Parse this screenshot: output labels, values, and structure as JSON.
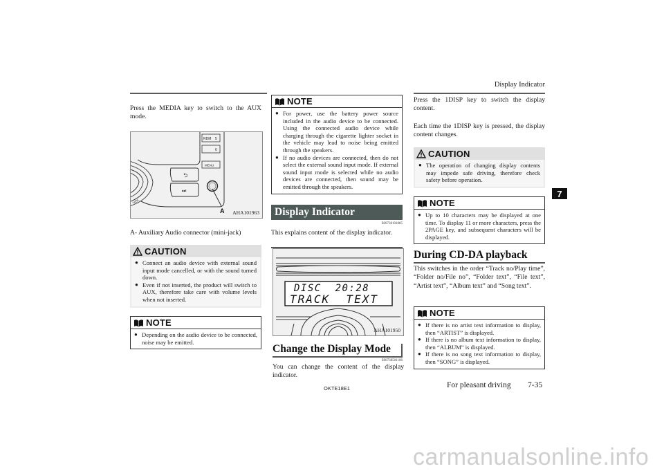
{
  "page": {
    "running_header": "Display Indicator",
    "chapter_tab": "7",
    "footer_code": "OKTE18E1",
    "footer_section": "For pleasant driving",
    "page_number": "7-35",
    "watermark": "carmanualsonline.info"
  },
  "col1": {
    "intro": "Press the MEDIA key to switch to the AUX mode.",
    "figure": {
      "code": "AHA101963",
      "labels": {
        "rdm": "RDM",
        "key5": "5",
        "key6": "6",
        "menu": "MENU",
        "callout": "A",
        "vol": "VOL"
      }
    },
    "figure_caption": "A- Auxiliary Audio connector (mini-jack)",
    "caution": {
      "icon": "warning-triangle-icon",
      "title": "CAUTION",
      "items": [
        "Connect an audio device with external sound input mode cancelled, or with the sound turned down.",
        "Even if not inserted, the product will switch to AUX, therefore take care with volume levels when not inserted."
      ]
    },
    "note": {
      "icon": "open-book-icon",
      "title": "NOTE",
      "items": [
        "Depending on the audio device to be connected, noise may be emitted."
      ]
    }
  },
  "col2": {
    "note": {
      "icon": "open-book-icon",
      "title": "NOTE",
      "items": [
        "For power, use the battery power source included in the audio device to be connected. Using the connected audio device while charging through the cigarette lighter socket in the vehicle may lead to noise being emitted through the speakers.",
        "If no audio devices are connected, then do not select the external sound input mode. If external sound input mode is selected while no audio devices are connected, then sound may be emitted through the speakers."
      ]
    },
    "section": {
      "title": "Display Indicator",
      "code": "E00738101085",
      "text": "This explains content of the display indicator."
    },
    "figure": {
      "code": "AHA101950",
      "lcd_line1": "DISC  20:28",
      "lcd_line2": "TRACK  TEXT"
    },
    "subsection": {
      "title": "Change the Display Mode",
      "code": "E00738501106",
      "text": "You can change the content of the display indicator."
    }
  },
  "col3": {
    "intro1": "Press the 1DISP key to switch the display content.",
    "intro2": "Each time the 1DISP key is pressed, the display content changes.",
    "caution": {
      "icon": "warning-triangle-icon",
      "title": "CAUTION",
      "items": [
        "The operation of changing display contents may impede safe driving, therefore check safety before operation."
      ]
    },
    "note1": {
      "icon": "open-book-icon",
      "title": "NOTE",
      "items": [
        "Up to 10 characters may be displayed at one time. To display 11 or more characters, press the 2PAGE key, and subsequent characters will be displayed."
      ]
    },
    "subsection": {
      "title": "During CD-DA playback",
      "text": "This switches in the order “Track no/Play time”, “Folder no/File no”, “Folder text”, “File text”, “Artist text”, “Album text” and “Song text”."
    },
    "note2": {
      "icon": "open-book-icon",
      "title": "NOTE",
      "items": [
        "If there is no artist text information to display, then “ARTIST” is displayed.",
        "If there is no album text information to display, then “ALBUM” is displayed.",
        "If there is no song text information to display, then “SONG” is displayed."
      ]
    }
  }
}
